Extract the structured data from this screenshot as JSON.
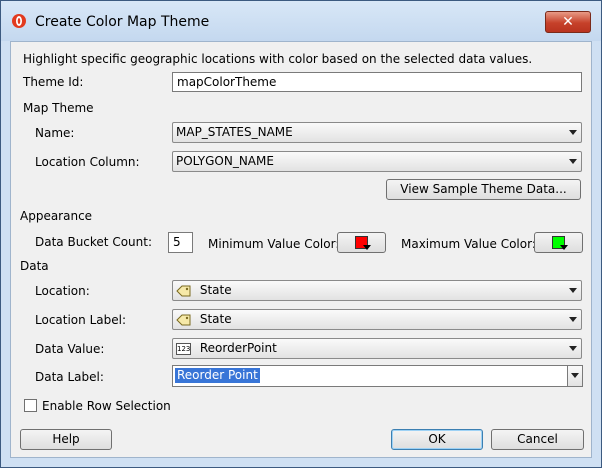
{
  "window": {
    "title": "Create Color Map Theme",
    "close_label": "✕"
  },
  "description": "Highlight specific geographic locations with color based on the selected data values.",
  "theme_id": {
    "label": "Theme Id:",
    "value": "mapColorTheme"
  },
  "map_theme": {
    "section_label": "Map Theme",
    "name": {
      "label": "Name:",
      "value": "MAP_STATES_NAME"
    },
    "location_column": {
      "label": "Location Column:",
      "value": "POLYGON_NAME"
    },
    "view_sample_label": "View Sample Theme Data..."
  },
  "appearance": {
    "section_label": "Appearance",
    "bucket_count": {
      "label": "Data Bucket Count:",
      "value": "5"
    },
    "min_color": {
      "label": "Minimum Value Color:",
      "color": "#ff0000"
    },
    "max_color": {
      "label": "Maximum Value Color:",
      "color": "#00ff00"
    }
  },
  "data": {
    "section_label": "Data",
    "location": {
      "label": "Location:",
      "value": "State"
    },
    "location_label": {
      "label": "Location Label:",
      "value": "State"
    },
    "data_value": {
      "label": "Data Value:",
      "value": "ReorderPoint"
    },
    "data_label": {
      "label": "Data Label:",
      "value": "Reorder Point"
    }
  },
  "enable_row_selection": {
    "label": "Enable Row Selection",
    "checked": false
  },
  "buttons": {
    "help": "Help",
    "ok": "OK",
    "cancel": "Cancel"
  },
  "icons": {
    "type_badge": "123"
  }
}
